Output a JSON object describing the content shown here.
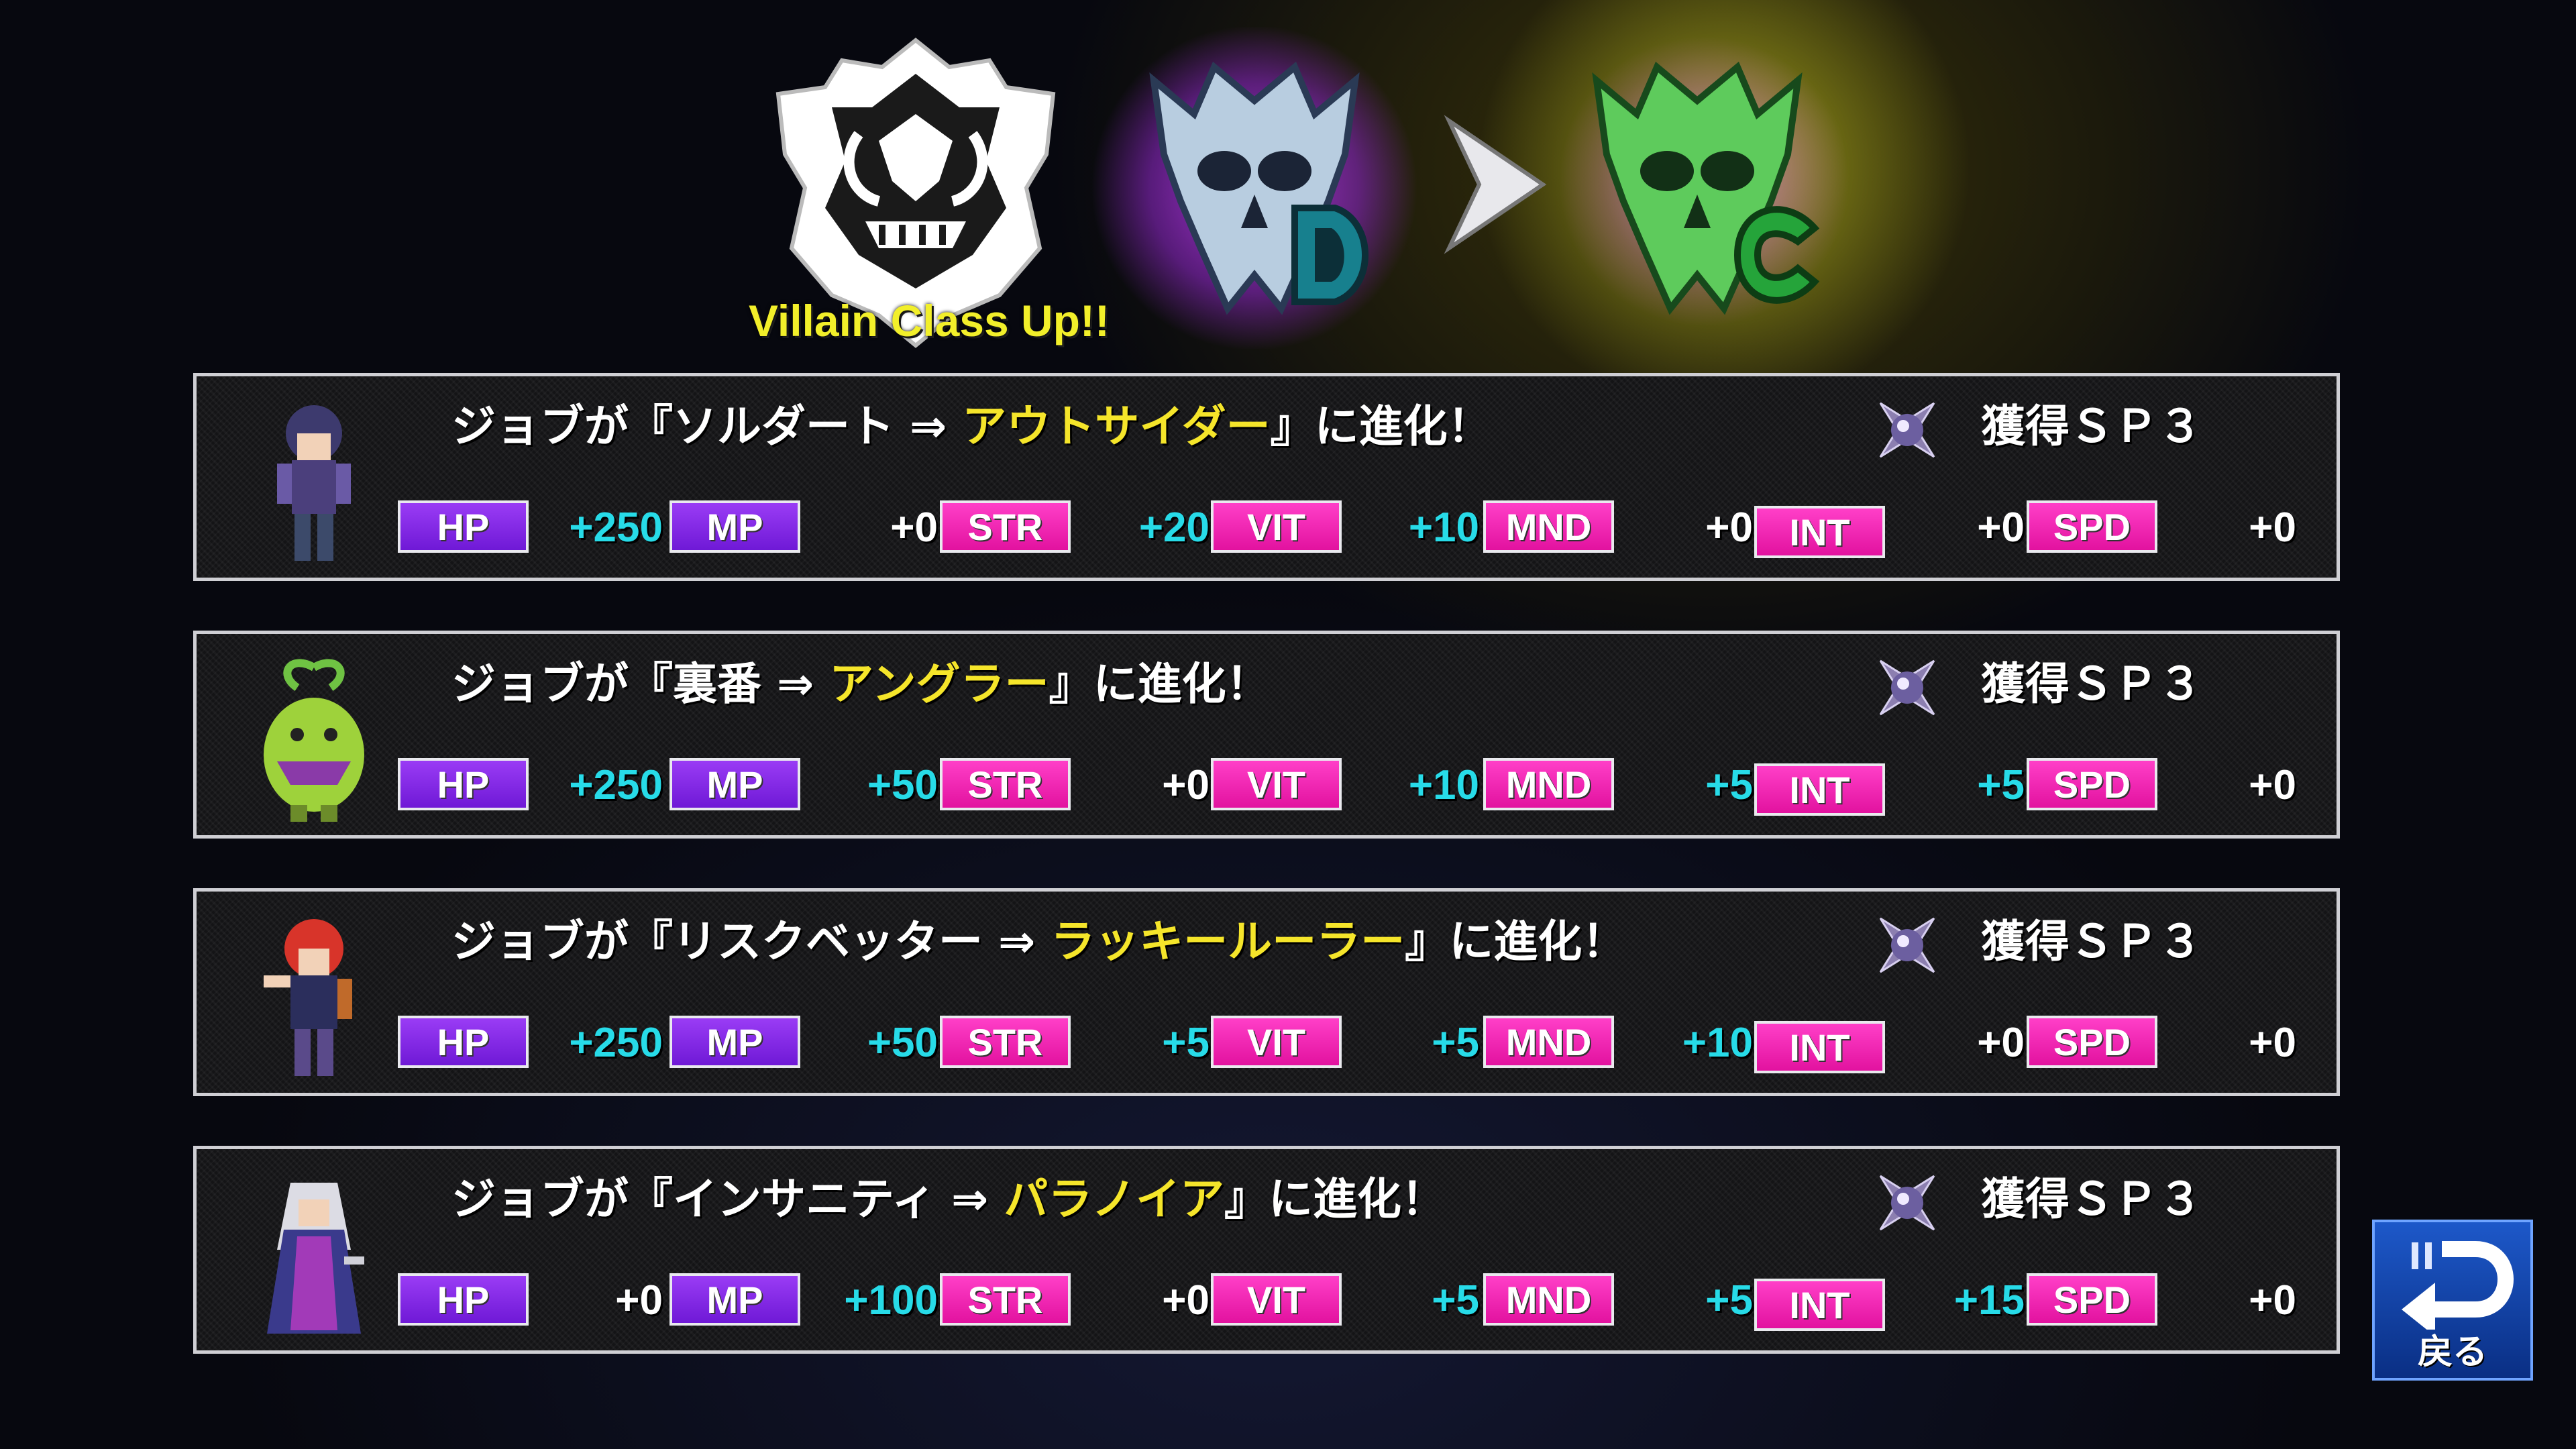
{
  "header": {
    "class_up_text": "Villain Class Up!!",
    "from_rank": "D",
    "to_rank": "C",
    "colors": {
      "from_glow": "#b43cff",
      "to_skull": "#59c75a",
      "to_glow": "#e6e63c",
      "highlight": "#f5e52a",
      "stat_positive": "#27dbe8"
    }
  },
  "labels": {
    "hp": "HP",
    "mp": "MP",
    "str": "STR",
    "vit": "VIT",
    "mnd": "MND",
    "int": "INT",
    "spd": "SPD"
  },
  "panels": [
    {
      "prefix": "ジョブが『ソルダート ⇒ ",
      "new_job": "アウトサイダー",
      "suffix": "』に進化！",
      "sp": "獲得ＳＰ３",
      "stats": {
        "hp": "+250",
        "mp": "+0",
        "str": "+20",
        "vit": "+10",
        "mnd": "+0",
        "int": "+0",
        "spd": "+0"
      }
    },
    {
      "prefix": "ジョブが『裏番 ⇒ ",
      "new_job": "アングラー",
      "suffix": "』に進化！",
      "sp": "獲得ＳＰ３",
      "stats": {
        "hp": "+250",
        "mp": "+50",
        "str": "+0",
        "vit": "+10",
        "mnd": "+5",
        "int": "+5",
        "spd": "+0"
      }
    },
    {
      "prefix": "ジョブが『リスクベッター ⇒ ",
      "new_job": "ラッキールーラー",
      "suffix": "』に進化！",
      "sp": "獲得ＳＰ３",
      "stats": {
        "hp": "+250",
        "mp": "+50",
        "str": "+5",
        "vit": "+5",
        "mnd": "+10",
        "int": "+0",
        "spd": "+0"
      }
    },
    {
      "prefix": "ジョブが『インサニティ ⇒ ",
      "new_job": "パラノイア",
      "suffix": "』に進化！",
      "sp": "獲得ＳＰ３",
      "stats": {
        "hp": "+0",
        "mp": "+100",
        "str": "+0",
        "vit": "+5",
        "mnd": "+5",
        "int": "+15",
        "spd": "+0"
      }
    }
  ],
  "back_button": {
    "label": "戻る",
    "icon": "return-arrow-icon"
  }
}
